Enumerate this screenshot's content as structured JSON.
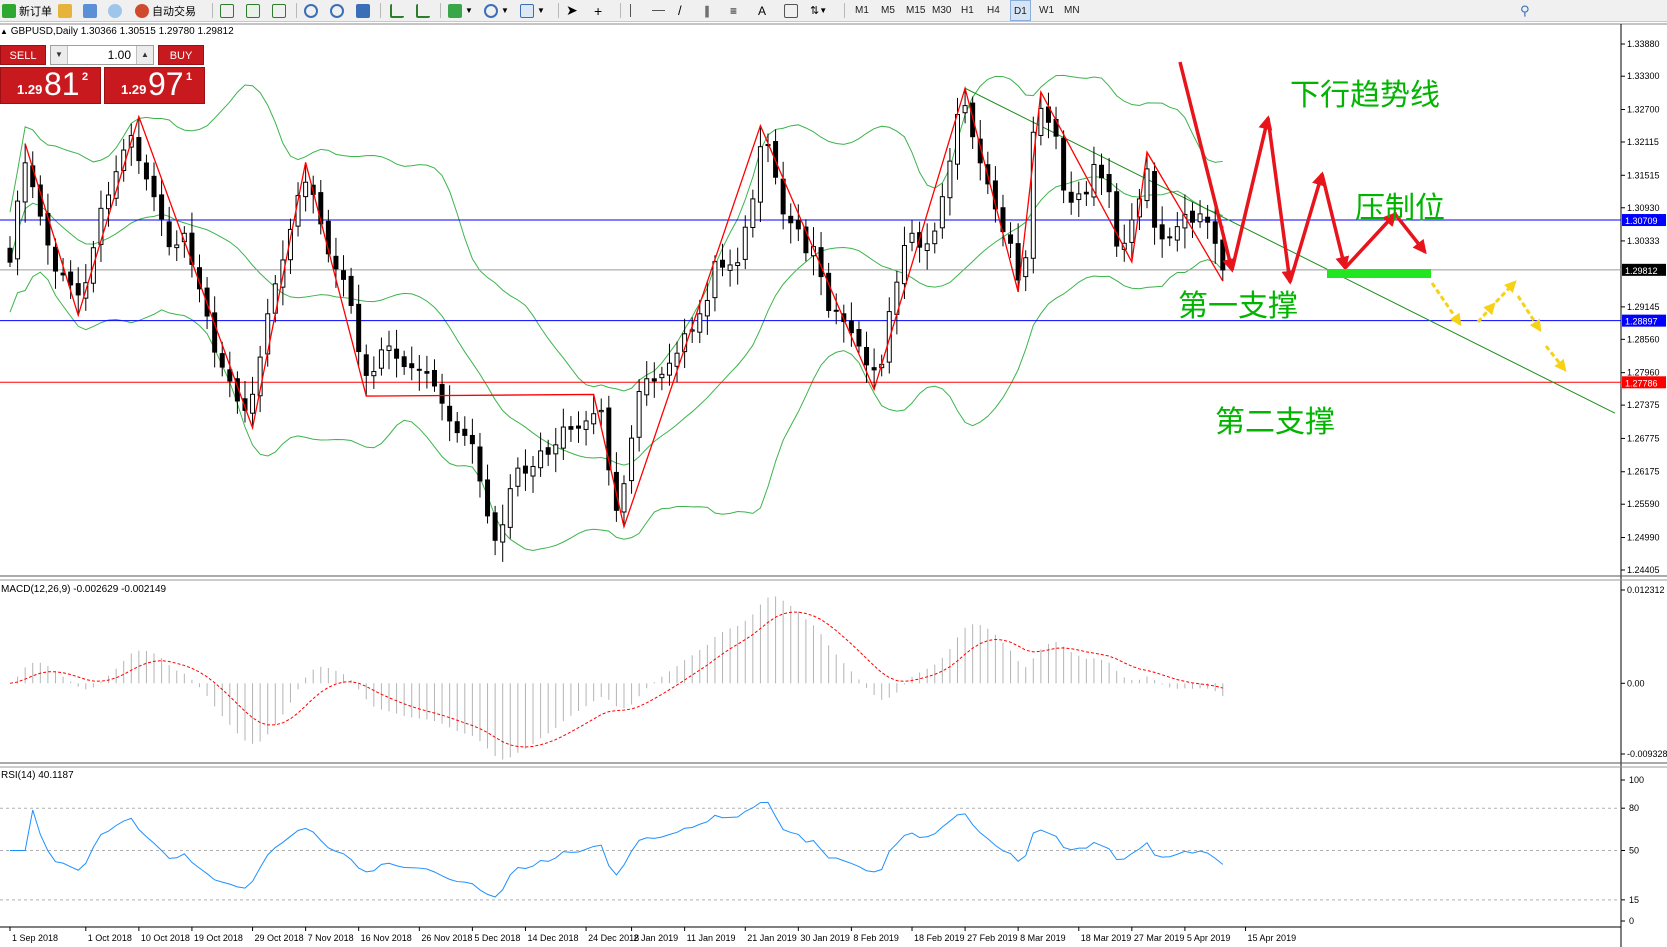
{
  "toolbar": {
    "new_order": "新订单",
    "auto_trading": "自动交易",
    "text_tool": "A",
    "timeframes": [
      "M1",
      "M5",
      "M15",
      "M30",
      "H1",
      "H4",
      "D1",
      "W1",
      "MN"
    ],
    "selected_timeframe": "D1"
  },
  "chart_title": "GBPUSD,Daily  1.30366 1.30515 1.29780 1.29812",
  "trade_panel": {
    "sell_label": "SELL",
    "buy_label": "BUY",
    "lot": "1.00",
    "sell": {
      "big": "1.29",
      "pips": "81",
      "point": "2"
    },
    "buy": {
      "big": "1.29",
      "pips": "97",
      "point": "1"
    },
    "color": "#c8191f"
  },
  "chart_data": [
    {
      "type": "candlestick",
      "name": "GBPUSD Daily price",
      "ohlc_last": {
        "open": 1.30366,
        "high": 1.30515,
        "low": 1.2978,
        "close": 1.29812
      },
      "ylim": [
        1.24405,
        1.3388
      ],
      "y_ticks": [
        "1.33880",
        "1.33300",
        "1.32700",
        "1.32115",
        "1.31515",
        "1.30930",
        "1.30333",
        "1.29145",
        "1.28560",
        "1.27960",
        "1.27375",
        "1.26775",
        "1.26175",
        "1.25590",
        "1.24990",
        "1.24405"
      ],
      "y_tick_values": [
        1.3388,
        1.333,
        1.327,
        1.32115,
        1.31515,
        1.3093,
        1.30333,
        1.29145,
        1.2856,
        1.2796,
        1.27375,
        1.26775,
        1.26175,
        1.2559,
        1.2499,
        1.24405
      ],
      "x_labels": [
        "1 Sep 2018",
        "1 Oct 2018",
        "10 Oct 2018",
        "19 Oct 2018",
        "29 Oct 2018",
        "7 Nov 2018",
        "16 Nov 2018",
        "26 Nov 2018",
        "5 Dec 2018",
        "14 Dec 2018",
        "24 Dec 2018",
        "2 Jan 2019",
        "11 Jan 2019",
        "21 Jan 2019",
        "30 Jan 2019",
        "8 Feb 2019",
        "18 Feb 2019",
        "27 Feb 2019",
        "8 Mar 2019",
        "18 Mar 2019",
        "27 Mar 2019",
        "5 Apr 2019",
        "15 Apr 2019"
      ],
      "x_label_index": [
        0,
        10,
        17,
        24,
        32,
        39,
        46,
        54,
        61,
        68,
        76,
        82,
        89,
        97,
        104,
        111,
        119,
        126,
        133,
        141,
        148,
        155,
        163
      ],
      "closes": [
        1.2995,
        1.3105,
        1.3174,
        1.3131,
        1.3078,
        1.3026,
        1.2979,
        1.2972,
        1.2954,
        1.2936,
        1.2958,
        1.3021,
        1.3092,
        1.3116,
        1.3158,
        1.3197,
        1.3223,
        1.3178,
        1.3145,
        1.3113,
        1.3073,
        1.3023,
        1.3026,
        1.3047,
        1.2991,
        1.2947,
        1.2898,
        1.2833,
        1.2806,
        1.2781,
        1.2745,
        1.2728,
        1.2757,
        1.2824,
        1.2902,
        1.2956,
        1.2999,
        1.3054,
        1.3115,
        1.3139,
        1.3117,
        1.3064,
        1.301,
        1.2983,
        1.2964,
        1.2917,
        1.2834,
        1.2791,
        1.2798,
        1.2837,
        1.2844,
        1.2822,
        1.2807,
        1.2805,
        1.2802,
        1.2795,
        1.2772,
        1.2741,
        1.2709,
        1.2688,
        1.2683,
        1.2668,
        1.2601,
        1.2538,
        1.2494,
        1.2522,
        1.2587,
        1.2624,
        1.2615,
        1.2627,
        1.2655,
        1.2649,
        1.2666,
        1.2698,
        1.2694,
        1.2696,
        1.2709,
        1.2722,
        1.2728,
        1.2621,
        1.2548,
        1.2596,
        1.2678,
        1.2762,
        1.2785,
        1.2781,
        1.2793,
        1.2813,
        1.2831,
        1.2866,
        1.2873,
        1.2902,
        1.2926,
        1.2996,
        1.2986,
        1.299,
        1.2994,
        1.3058,
        1.3109,
        1.3203,
        1.3207,
        1.3148,
        1.3082,
        1.3066,
        1.3055,
        1.3012,
        1.3023,
        1.2969,
        1.2908,
        1.2908,
        1.2888,
        1.2868,
        1.2844,
        1.281,
        1.2801,
        1.2811,
        1.2906,
        1.2959,
        1.3025,
        1.3047,
        1.3022,
        1.3028,
        1.3051,
        1.3113,
        1.3177,
        1.3261,
        1.3277,
        1.3221,
        1.3174,
        1.3136,
        1.3091,
        1.305,
        1.3029,
        1.2963,
        1.3003,
        1.3229,
        1.3272,
        1.3247,
        1.3222,
        1.3125,
        1.3103,
        1.3118,
        1.3118,
        1.3171,
        1.3147,
        1.3122,
        1.3024,
        1.3029,
        1.3071,
        1.3109,
        1.3163,
        1.3058,
        1.3037,
        1.304,
        1.3059,
        1.3081,
        1.3067,
        1.3082,
        1.3067,
        1.3029,
        1.2981
      ],
      "horizontal_levels": [
        {
          "label": "1.30709",
          "value": 1.30709,
          "color": "#0000ff"
        },
        {
          "label": "1.29812",
          "value": 1.29812,
          "color": "#000000"
        },
        {
          "label": "1.28897",
          "value": 1.28897,
          "color": "#0000ff"
        },
        {
          "label": "1.27786",
          "value": 1.27786,
          "color": "#ff0000"
        }
      ],
      "overlays": [
        "Bollinger Bands",
        "ZigZag",
        "trendline"
      ],
      "colors": {
        "bull": "#ffffff",
        "bear": "#000000",
        "bands": "#3cb44b",
        "zigzag": "#ff0000",
        "trendline": "#1e8c1e"
      },
      "annotations": [
        {
          "text": "下行趋势线",
          "color": "#00b400"
        },
        {
          "text": "压制位",
          "color": "#00b400"
        },
        {
          "text": "第一支撑",
          "color": "#00b400"
        },
        {
          "text": "第二支撑",
          "color": "#00b400"
        }
      ],
      "arrow_colors": {
        "pattern": "#e8141c",
        "projection": "#f5d214",
        "support_bar": "#22e622"
      }
    },
    {
      "type": "bar",
      "name": "MACD",
      "label": "MACD(12,26,9) -0.002629 -0.002149",
      "ylim": [
        -0.009328,
        0.012312
      ],
      "y_ticks": [
        "0.012312",
        "0.00",
        "-0.009328"
      ],
      "y_tick_values": [
        0.012312,
        0,
        -0.009328
      ],
      "histogram_color": "#b4b4b4",
      "signal_color": "#ff0000"
    },
    {
      "type": "line",
      "name": "RSI",
      "label": "RSI(14) 40.1187",
      "ylim": [
        0,
        100
      ],
      "y_ticks": [
        "100",
        "80",
        "50",
        "15",
        "0"
      ],
      "y_tick_values": [
        100,
        80,
        50,
        15,
        0
      ],
      "levels": [
        80,
        50,
        15
      ],
      "line_color": "#1e90ff"
    }
  ]
}
